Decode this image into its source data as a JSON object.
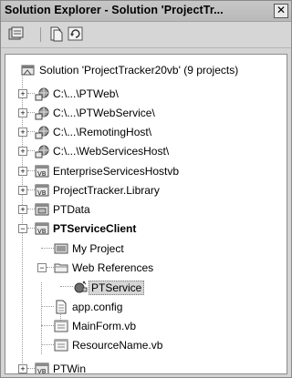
{
  "window": {
    "title": "Solution Explorer - Solution 'ProjectTr...",
    "close_symbol": "✕"
  },
  "toolbar": {
    "buttons": [
      {
        "name": "properties-icon"
      },
      {
        "name": "show-all-files-icon"
      },
      {
        "name": "refresh-icon"
      }
    ]
  },
  "tree": {
    "solution": "Solution 'ProjectTracker20vb' (9 projects)",
    "items": [
      {
        "label": "C:\\...\\PTWeb\\",
        "icon": "web-project-icon",
        "expander": "+"
      },
      {
        "label": "C:\\...\\PTWebService\\",
        "icon": "web-project-icon",
        "expander": "+"
      },
      {
        "label": "C:\\...\\RemotingHost\\",
        "icon": "web-project-icon",
        "expander": "+"
      },
      {
        "label": "C:\\...\\WebServicesHost\\",
        "icon": "web-project-icon",
        "expander": "+"
      },
      {
        "label": "EnterpriseServicesHostvb",
        "icon": "vb-project-icon",
        "expander": "+"
      },
      {
        "label": "ProjectTracker.Library",
        "icon": "vb-project-icon",
        "expander": "+"
      },
      {
        "label": "PTData",
        "icon": "data-project-icon",
        "expander": "+"
      },
      {
        "label": "PTServiceClient",
        "icon": "vb-project-icon",
        "expander": "−"
      },
      {
        "label": "My Project",
        "icon": "my-project-icon"
      },
      {
        "label": "Web References",
        "icon": "folder-icon",
        "expander": "−"
      },
      {
        "label": "PTService",
        "icon": "web-service-icon"
      },
      {
        "label": "app.config",
        "icon": "config-file-icon"
      },
      {
        "label": "MainForm.vb",
        "icon": "form-file-icon"
      },
      {
        "label": "ResourceName.vb",
        "icon": "form-file-icon"
      },
      {
        "label": "PTWin",
        "icon": "vb-project-icon",
        "expander": "+"
      }
    ]
  }
}
